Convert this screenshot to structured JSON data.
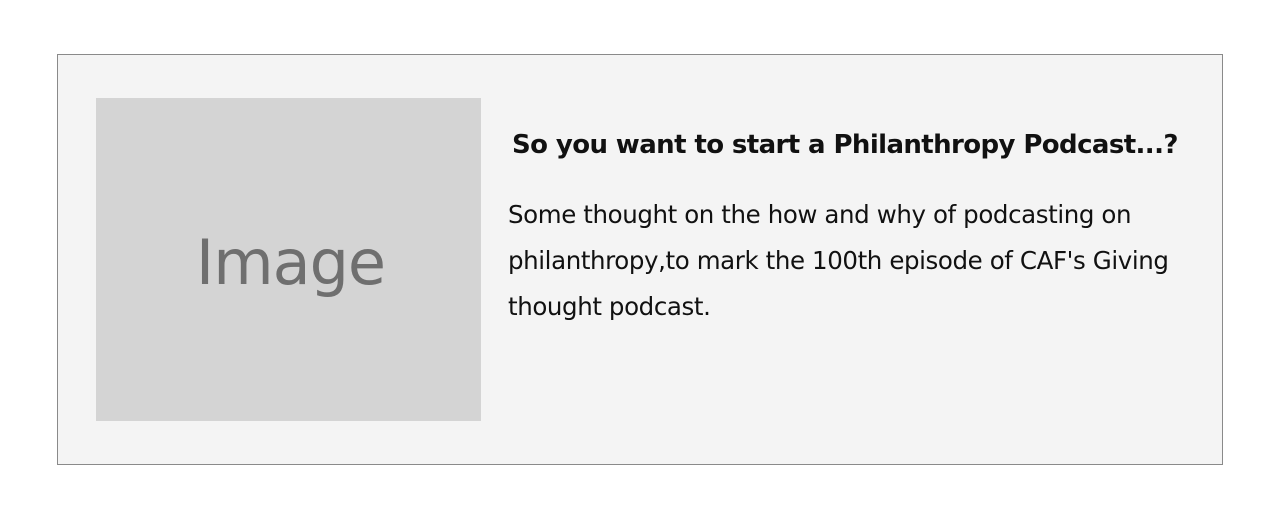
{
  "card": {
    "image_placeholder": "Image",
    "title": "So you want to start a Philanthropy Podcast...?",
    "description": "Some thought on the how and why of podcasting on philanthropy,to mark the 100th episode of CAF's Giving thought podcast."
  },
  "colors": {
    "page_background": "#ffffff",
    "card_background": "#f4f4f4",
    "card_border": "#8a8a8a",
    "placeholder_background": "#d4d4d4",
    "placeholder_text": "#6f6f6f",
    "text": "#111111"
  }
}
